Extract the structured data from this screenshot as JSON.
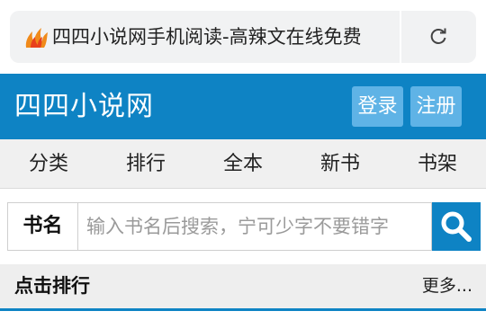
{
  "browser": {
    "page_title": "四四小说网手机阅读-高辣文在线免费",
    "favicon_icon": "flame-logo-icon",
    "reload_icon": "reload-icon"
  },
  "header": {
    "site_name": "四四小说网",
    "login_label": "登录",
    "register_label": "注册",
    "brand_color": "#0e83c4",
    "button_color": "#5fb3e6"
  },
  "nav": {
    "items": [
      "分类",
      "排行",
      "全本",
      "新书",
      "书架"
    ]
  },
  "search": {
    "type_label": "书名",
    "placeholder": "输入书名后搜索，宁可少字不要错字",
    "button_icon": "search-icon"
  },
  "section": {
    "title": "点击排行",
    "more_label": "更多..."
  }
}
